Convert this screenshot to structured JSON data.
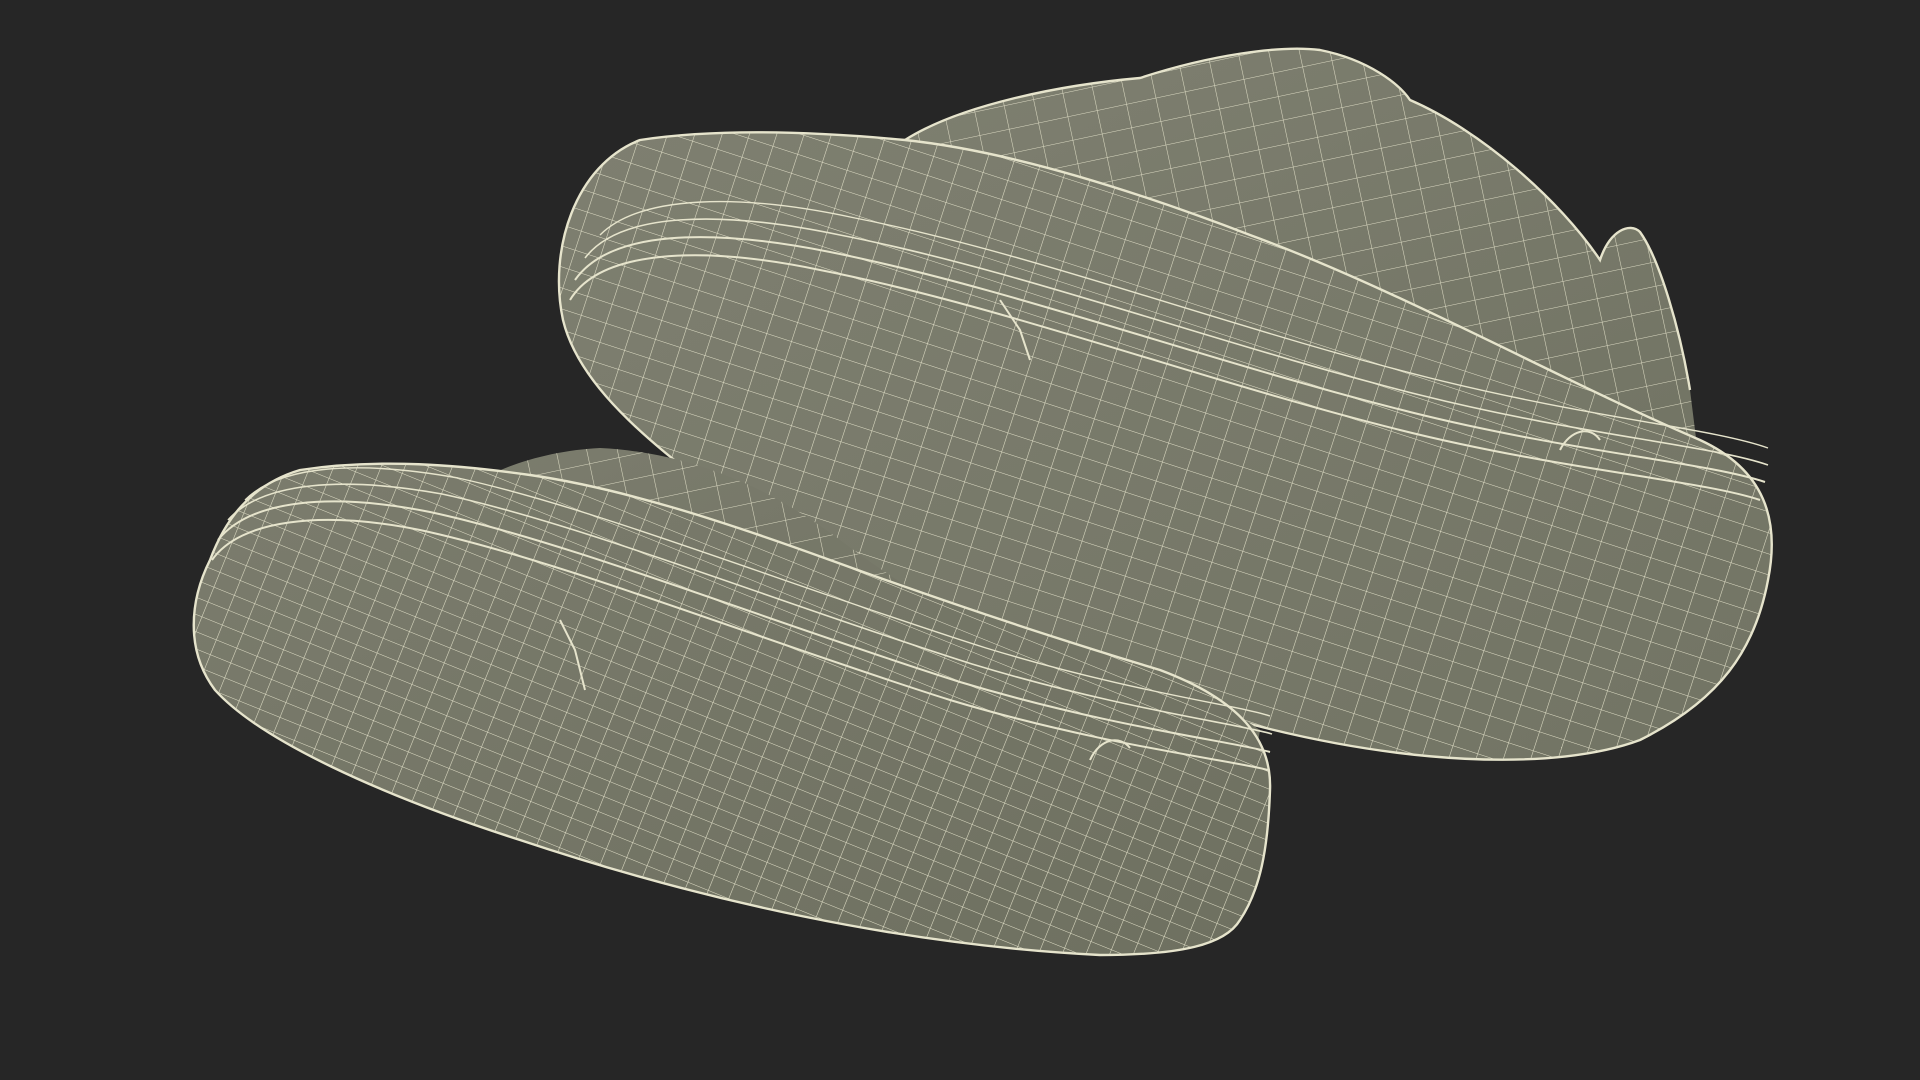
{
  "scene": {
    "background_color": "#262626",
    "surface_color": "#7a7b6c",
    "surface_shade_color": "#666858",
    "wire_color": "#e6e4cc",
    "subject": "wireframe-shoe-pair",
    "render_mode": "wireframe-on-shaded"
  }
}
